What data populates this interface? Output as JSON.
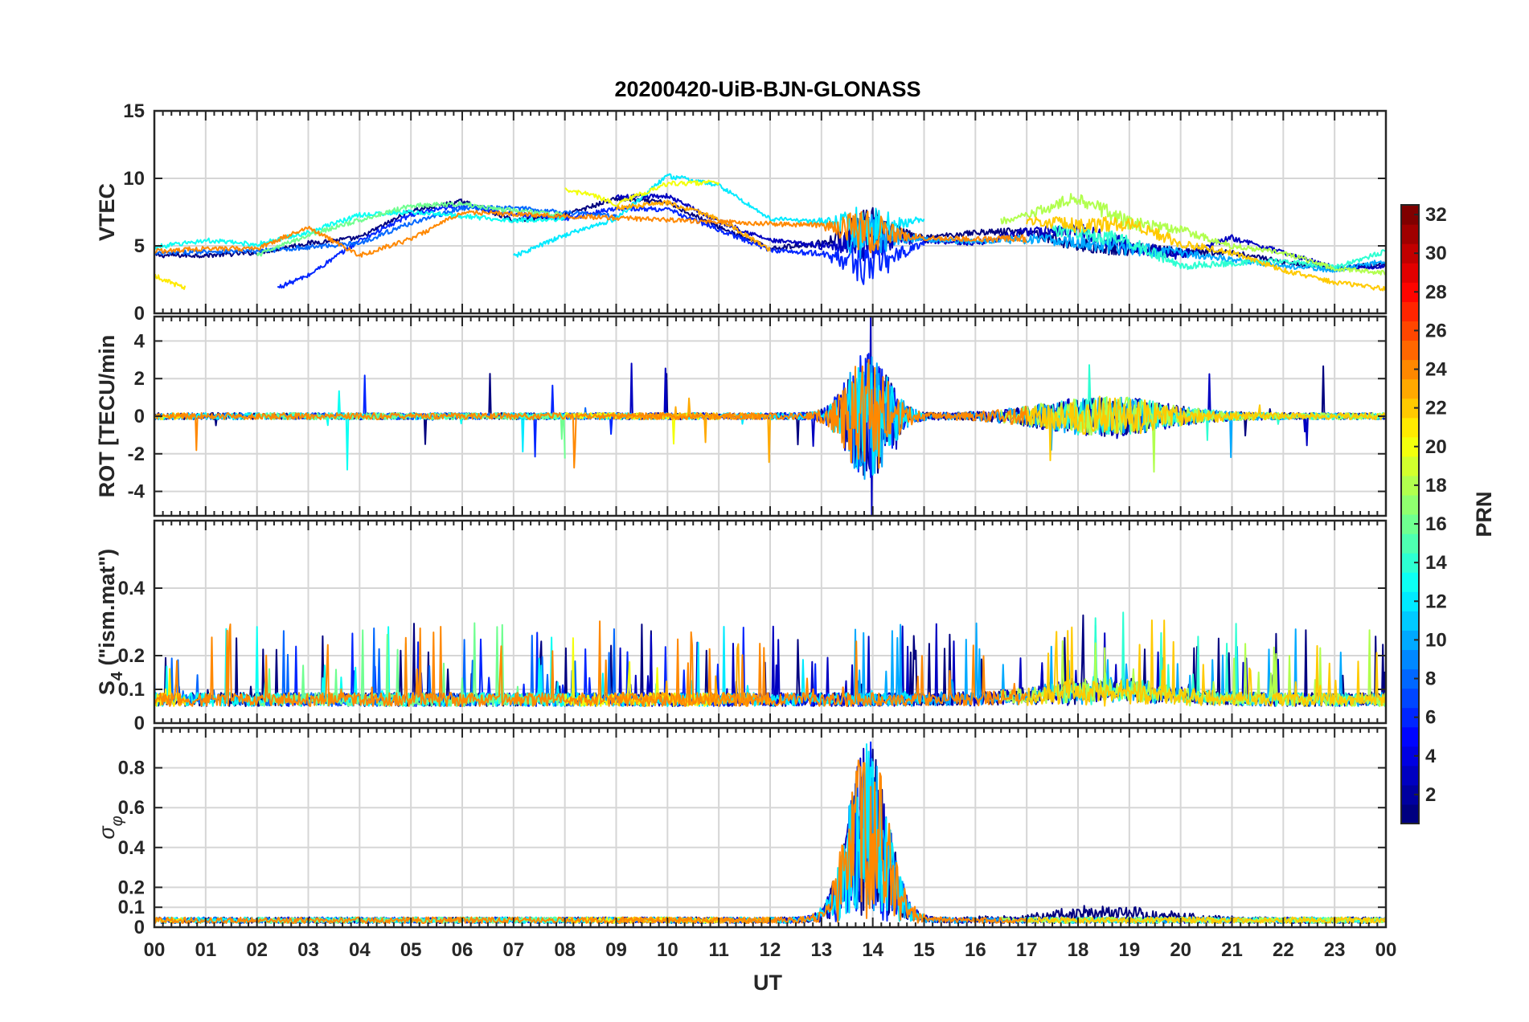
{
  "chart_data": {
    "type": "line",
    "title": "20200420-UiB-BJN-GLONASS",
    "xlabel": "UT",
    "x_tick_labels": [
      "00",
      "01",
      "02",
      "03",
      "04",
      "05",
      "06",
      "07",
      "08",
      "09",
      "10",
      "11",
      "12",
      "13",
      "14",
      "15",
      "16",
      "17",
      "18",
      "19",
      "20",
      "21",
      "22",
      "23",
      "00"
    ],
    "xlim": [
      0,
      24
    ],
    "grid": true,
    "panels": [
      {
        "id": "vtec",
        "ylabel": "VTEC",
        "ylim": [
          0,
          15
        ],
        "y_ticks": [
          0,
          5,
          10,
          15
        ],
        "y_tick_labels": [
          "0",
          "5",
          "10",
          "15"
        ]
      },
      {
        "id": "rot",
        "ylabel": "ROT [TECU/min",
        "ylim": [
          -5.3,
          5.3
        ],
        "y_ticks": [
          -4,
          -2,
          0,
          2,
          4
        ],
        "y_tick_labels": [
          "-4",
          "-2",
          "0",
          "2",
          "4"
        ]
      },
      {
        "id": "s4",
        "ylabel_main": "S",
        "ylabel_sub": "4",
        "ylabel_rest": " (\"ism.mat\")",
        "ylim": [
          0,
          0.6
        ],
        "y_ticks": [
          0,
          0.1,
          0.2,
          0.4
        ],
        "y_tick_labels": [
          "0",
          "0.1",
          "0.2",
          "0.4"
        ]
      },
      {
        "id": "sigma",
        "ylabel_main": "σ",
        "ylabel_sub": "φ",
        "ylim": [
          0,
          1.0
        ],
        "y_ticks": [
          0,
          0.1,
          0.2,
          0.4,
          0.6,
          0.8
        ],
        "y_tick_labels": [
          "0",
          "0.1",
          "0.2",
          "0.4",
          "0.6",
          "0.8"
        ]
      }
    ],
    "colorbar": {
      "label": "PRN",
      "range": [
        1,
        32
      ],
      "tick_values": [
        2,
        4,
        6,
        8,
        10,
        12,
        14,
        16,
        18,
        20,
        22,
        24,
        26,
        28,
        30,
        32
      ],
      "tick_labels": [
        "2",
        "4",
        "6",
        "8",
        "10",
        "12",
        "14",
        "16",
        "18",
        "20",
        "22",
        "24",
        "26",
        "28",
        "30",
        "32"
      ],
      "colormap": "jet"
    },
    "series": [
      {
        "prn": 1,
        "vtec_start": 0.0,
        "vtec_end": 24.0,
        "vtec_points": [
          [
            0,
            4.3
          ],
          [
            1,
            4.3
          ],
          [
            2,
            4.5
          ],
          [
            3,
            5.2
          ],
          [
            4,
            5.6
          ],
          [
            5,
            7.6
          ],
          [
            6,
            8.3
          ],
          [
            7,
            6.9
          ],
          [
            8,
            7.3
          ],
          [
            9,
            8.5
          ],
          [
            10,
            8.2
          ],
          [
            11,
            6.4
          ],
          [
            12,
            4.8
          ],
          [
            13,
            5.2
          ],
          [
            14,
            6.3
          ],
          [
            15,
            5.6
          ],
          [
            16,
            6.0
          ],
          [
            17,
            6.1
          ],
          [
            18,
            5.0
          ],
          [
            19,
            4.8
          ],
          [
            20,
            4.5
          ],
          [
            21,
            4.5
          ],
          [
            22,
            3.8
          ],
          [
            23,
            3.3
          ],
          [
            24,
            3.7
          ]
        ]
      },
      {
        "prn": 3,
        "vtec_start": 9.0,
        "vtec_end": 24.0,
        "vtec_points": [
          [
            9,
            8.6
          ],
          [
            10,
            8.7
          ],
          [
            11,
            6.8
          ],
          [
            12,
            5.4
          ],
          [
            13,
            5.0
          ],
          [
            14,
            5.6
          ],
          [
            15,
            5.4
          ],
          [
            16,
            5.2
          ],
          [
            17,
            6.0
          ],
          [
            18,
            6.2
          ],
          [
            19,
            5.0
          ],
          [
            20,
            4.3
          ],
          [
            21,
            5.6
          ],
          [
            22,
            4.5
          ],
          [
            23,
            3.4
          ],
          [
            24,
            3.5
          ]
        ]
      },
      {
        "prn": 6,
        "vtec_start": 2.4,
        "vtec_end": 15.0,
        "vtec_points": [
          [
            2.4,
            1.9
          ],
          [
            3,
            2.8
          ],
          [
            4,
            5.4
          ],
          [
            5,
            7.3
          ],
          [
            6,
            8.0
          ],
          [
            7,
            7.4
          ],
          [
            8,
            7.0
          ],
          [
            9,
            7.8
          ],
          [
            10,
            7.7
          ],
          [
            11,
            6.2
          ],
          [
            12,
            4.7
          ],
          [
            13,
            4.4
          ],
          [
            14,
            3.5
          ],
          [
            15,
            5.2
          ]
        ]
      },
      {
        "prn": 8,
        "vtec_start": 0.0,
        "vtec_end": 9.0,
        "vtec_points": [
          [
            0,
            4.4
          ],
          [
            1,
            4.6
          ],
          [
            2,
            4.6
          ],
          [
            3,
            4.9
          ],
          [
            4,
            5.2
          ],
          [
            5,
            6.7
          ],
          [
            6,
            7.8
          ],
          [
            7,
            7.8
          ],
          [
            8,
            7.5
          ],
          [
            9,
            7.2
          ]
        ]
      },
      {
        "prn": 10,
        "vtec_start": 13.5,
        "vtec_end": 24.0,
        "vtec_points": [
          [
            13.5,
            5.5
          ],
          [
            14,
            5.8
          ],
          [
            15,
            5.5
          ],
          [
            16,
            5.3
          ],
          [
            17,
            5.5
          ],
          [
            18,
            5.3
          ],
          [
            19,
            4.8
          ],
          [
            20,
            4.5
          ],
          [
            21,
            4.0
          ],
          [
            22,
            3.5
          ],
          [
            23,
            3.2
          ],
          [
            24,
            3.9
          ]
        ]
      },
      {
        "prn": 12,
        "vtec_start": 7.0,
        "vtec_end": 15.0,
        "vtec_points": [
          [
            7,
            4.2
          ],
          [
            8,
            5.8
          ],
          [
            9,
            7.0
          ],
          [
            10,
            10.2
          ],
          [
            11,
            9.5
          ],
          [
            12,
            7.0
          ],
          [
            13,
            6.8
          ],
          [
            14,
            6.2
          ],
          [
            15,
            7.0
          ]
        ]
      },
      {
        "prn": 13,
        "vtec_start": 0.0,
        "vtec_end": 8.0,
        "vtec_points": [
          [
            0,
            4.9
          ],
          [
            1,
            5.4
          ],
          [
            2,
            5.1
          ],
          [
            3,
            6.0
          ],
          [
            4,
            7.3
          ],
          [
            5,
            7.5
          ],
          [
            6,
            7.2
          ],
          [
            7,
            6.9
          ],
          [
            8,
            7.0
          ]
        ]
      },
      {
        "prn": 14,
        "vtec_start": 17.5,
        "vtec_end": 24.0,
        "vtec_points": [
          [
            17.5,
            6.2
          ],
          [
            18,
            6.0
          ],
          [
            19,
            5.3
          ],
          [
            20,
            3.5
          ],
          [
            21,
            3.7
          ],
          [
            22,
            3.9
          ],
          [
            23,
            3.4
          ],
          [
            24,
            4.6
          ]
        ]
      },
      {
        "prn": 16,
        "vtec_start": 2.0,
        "vtec_end": 8.0,
        "vtec_points": [
          [
            2,
            4.3
          ],
          [
            3,
            5.8
          ],
          [
            4,
            6.9
          ],
          [
            5,
            8.0
          ],
          [
            6,
            8.1
          ],
          [
            7,
            7.6
          ],
          [
            8,
            7.3
          ]
        ]
      },
      {
        "prn": 18,
        "vtec_start": 16.5,
        "vtec_end": 24.0,
        "vtec_points": [
          [
            16.5,
            6.8
          ],
          [
            17,
            7.2
          ],
          [
            18,
            8.6
          ],
          [
            19,
            6.7
          ],
          [
            20,
            6.2
          ],
          [
            21,
            5.0
          ],
          [
            22,
            4.5
          ],
          [
            23,
            3.3
          ],
          [
            24,
            3.0
          ]
        ]
      },
      {
        "prn": 20,
        "vtec_start": 8.0,
        "vtec_end": 11.0,
        "vtec_points": [
          [
            8,
            9.1
          ],
          [
            8.5,
            8.8
          ],
          [
            9,
            8.1
          ],
          [
            10,
            9.6
          ],
          [
            11,
            9.7
          ]
        ]
      },
      {
        "prn": 21,
        "vtec_start": 0.0,
        "vtec_end": 0.6,
        "vtec_points": [
          [
            0,
            2.8
          ],
          [
            0.3,
            2.3
          ],
          [
            0.6,
            1.9
          ]
        ]
      },
      {
        "prn": 22,
        "vtec_start": 17.0,
        "vtec_end": 24.0,
        "vtec_points": [
          [
            17,
            6.9
          ],
          [
            18,
            6.5
          ],
          [
            19,
            6.7
          ],
          [
            20,
            5.2
          ],
          [
            21,
            4.5
          ],
          [
            22,
            3.2
          ],
          [
            23,
            2.3
          ],
          [
            24,
            1.8
          ]
        ]
      },
      {
        "prn": 23,
        "vtec_start": 9.0,
        "vtec_end": 12.0,
        "vtec_points": [
          [
            9,
            7.8
          ],
          [
            10,
            8.2
          ],
          [
            11,
            7.0
          ],
          [
            12,
            4.7
          ]
        ]
      },
      {
        "prn": 24,
        "vtec_start": 0.0,
        "vtec_end": 17.0,
        "vtec_points": [
          [
            0,
            4.6
          ],
          [
            1,
            4.8
          ],
          [
            2,
            4.8
          ],
          [
            3,
            6.4
          ],
          [
            4,
            4.3
          ],
          [
            5,
            5.5
          ],
          [
            6,
            7.5
          ],
          [
            13,
            6.5
          ],
          [
            14,
            6.0
          ],
          [
            15,
            5.6
          ],
          [
            16,
            5.5
          ],
          [
            17,
            5.5
          ]
        ]
      }
    ]
  }
}
